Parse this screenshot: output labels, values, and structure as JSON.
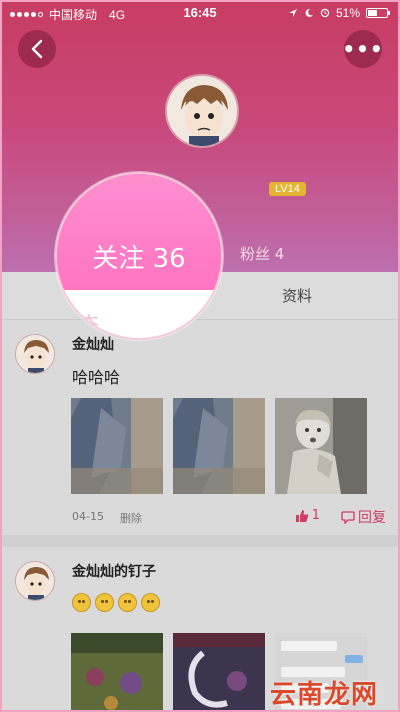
{
  "statusbar": {
    "carrier": "中国移动",
    "network": "4G",
    "time": "16:45",
    "battery": "51%",
    "battery_level": 0.51
  },
  "nav": {
    "back_icon": "chevron-left-icon",
    "more_icon": "more-icon",
    "more_label": "•••"
  },
  "profile": {
    "level": "LV14",
    "follow_label": "关注 36",
    "fans_label": "粉丝 4"
  },
  "tabs": {
    "partial_label": "态",
    "material_label": "资料"
  },
  "posts": [
    {
      "author": "金灿灿",
      "text": "哈哈哈",
      "date": "04-15",
      "delete_label": "删除",
      "likes": "1",
      "reply_label": "回复"
    },
    {
      "author": "金灿灿的钉子"
    }
  ],
  "watermark": "云南龙网",
  "colors": {
    "header_top": "#c83d62",
    "header_bottom": "#bd6fae",
    "accent": "#d23b62",
    "magnifier": "#ff80c7"
  }
}
